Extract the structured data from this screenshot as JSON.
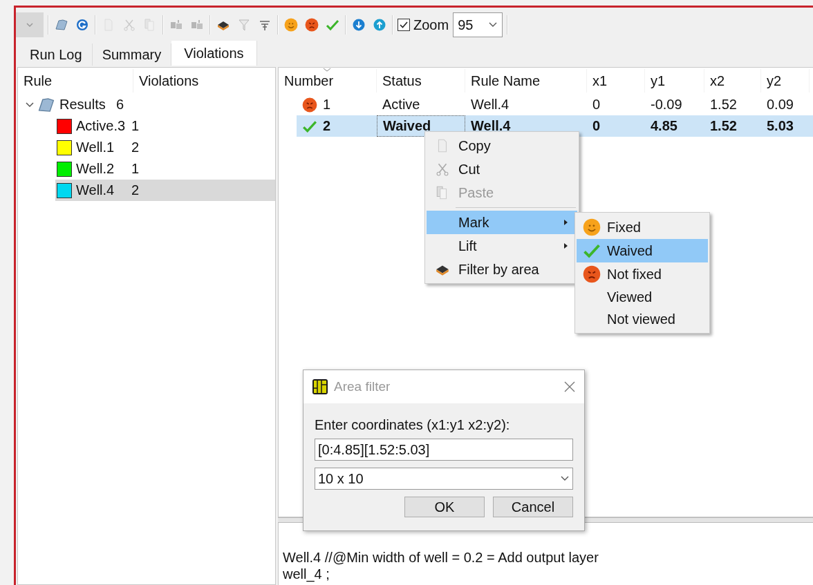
{
  "toolbar": {
    "buttons": [
      {
        "kind": "caret",
        "disabled": true
      },
      {
        "kind": "folder",
        "disabled": false
      },
      {
        "kind": "refresh",
        "disabled": false
      },
      {
        "kind": "copy",
        "disabled": true
      },
      {
        "kind": "cut",
        "disabled": true
      },
      {
        "kind": "paste",
        "disabled": true
      },
      {
        "kind": "move",
        "disabled": true
      },
      {
        "kind": "move",
        "disabled": true
      },
      {
        "kind": "chip",
        "disabled": false
      },
      {
        "kind": "funnel",
        "disabled": true
      },
      {
        "kind": "filter",
        "disabled": false
      },
      {
        "kind": "happy",
        "disabled": false
      },
      {
        "kind": "angry",
        "disabled": false
      },
      {
        "kind": "check",
        "disabled": false
      },
      {
        "kind": "down",
        "disabled": false
      },
      {
        "kind": "up",
        "disabled": false
      }
    ],
    "zoom": {
      "label": "Zoom",
      "checked": true,
      "value": "95"
    }
  },
  "tabs": [
    {
      "label": "Run Log",
      "selected": false
    },
    {
      "label": "Summary",
      "selected": false
    },
    {
      "label": "Violations",
      "selected": true
    }
  ],
  "tree": {
    "columns": [
      "Rule",
      "Violations"
    ],
    "items": [
      {
        "label": "Results",
        "count": "6",
        "expanded": true,
        "selected": false,
        "children": [
          {
            "label": "Active.3",
            "count": "1",
            "color": "#ff0000",
            "selected": false
          },
          {
            "label": "Well.1",
            "count": "2",
            "color": "#ffff00",
            "selected": false
          },
          {
            "label": "Well.2",
            "count": "1",
            "color": "#00ee00",
            "selected": false
          },
          {
            "label": "Well.4",
            "count": "2",
            "color": "#00d8f0",
            "selected": true
          }
        ]
      }
    ]
  },
  "table": {
    "columns": [
      "Number",
      "Status",
      "Rule Name",
      "x1",
      "y1",
      "x2",
      "y2"
    ],
    "rows": [
      {
        "kind": "not_fixed",
        "selected": false,
        "cells": [
          "1",
          "Active",
          "Well.4",
          "0",
          "-0.09",
          "1.52",
          "0.09"
        ]
      },
      {
        "kind": "waived",
        "selected": true,
        "cells": [
          "2",
          "Waived",
          "Well.4",
          "0",
          "4.85",
          "1.52",
          "5.03"
        ]
      }
    ]
  },
  "details": [
    "Well.4 //@Min width of well = 0.2 = Add output layer",
    "well_4 ;"
  ],
  "context_menu": {
    "items": [
      {
        "kind": "copy",
        "label": "Copy",
        "disabled": false,
        "selected": false,
        "submenu": false
      },
      {
        "kind": "cut",
        "label": "Cut",
        "disabled": false,
        "selected": false,
        "submenu": false
      },
      {
        "kind": "paste",
        "label": "Paste",
        "disabled": true,
        "selected": false,
        "submenu": false
      },
      {
        "kind": "separator"
      },
      {
        "kind": "none",
        "label": "Mark",
        "disabled": false,
        "selected": true,
        "submenu": true
      },
      {
        "kind": "none",
        "label": "Lift",
        "disabled": false,
        "selected": false,
        "submenu": true
      },
      {
        "kind": "chip",
        "label": "Filter by area",
        "disabled": false,
        "selected": false,
        "submenu": false
      }
    ],
    "submenu": [
      {
        "kind": "happy",
        "label": "Fixed",
        "selected": false
      },
      {
        "kind": "check",
        "label": "Waived",
        "selected": true
      },
      {
        "kind": "angry",
        "label": "Not fixed",
        "selected": false
      },
      {
        "kind": "none",
        "label": "Viewed",
        "selected": false
      },
      {
        "kind": "none",
        "label": "Not viewed",
        "selected": false
      }
    ]
  },
  "dialog": {
    "title": "Area filter",
    "label": "Enter coordinates (x1:y1 x2:y2):",
    "value": "[0:4.85][1.52:5.03]",
    "grid": "10 x 10",
    "buttons": [
      "OK",
      "Cancel"
    ]
  }
}
